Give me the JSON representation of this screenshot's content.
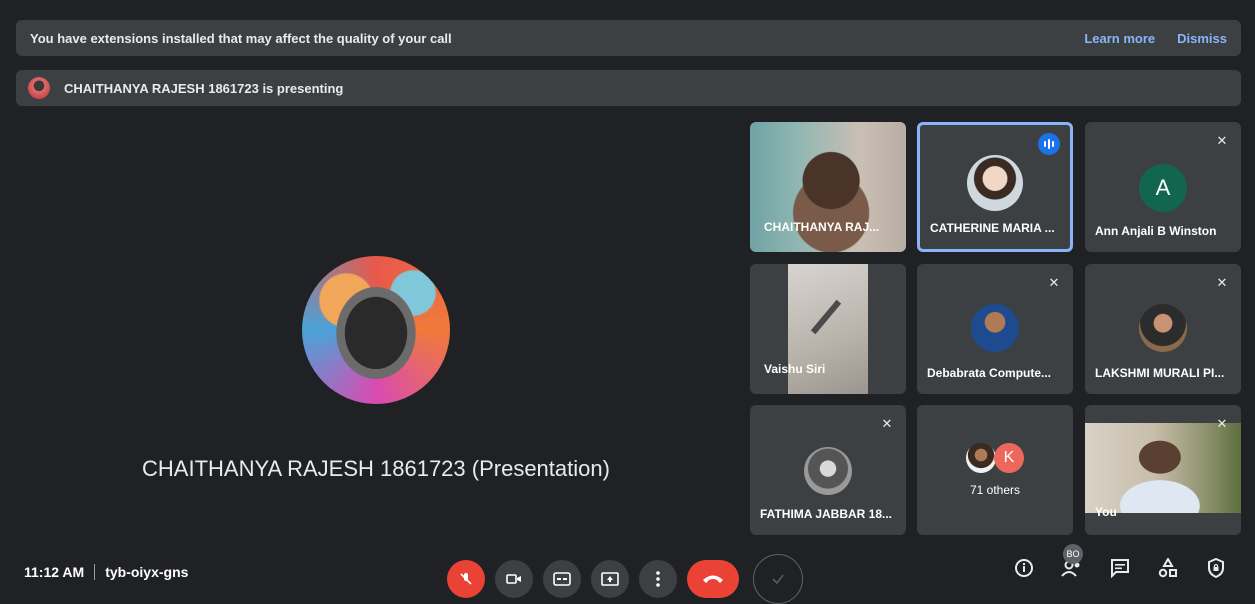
{
  "extension_banner": {
    "message": "You have extensions installed that may affect the quality of your call",
    "learn_more": "Learn more",
    "dismiss": "Dismiss"
  },
  "presenting_banner": {
    "text": "CHAITHANYA RAJESH 1861723 is presenting"
  },
  "main_tile": {
    "name": "CHAITHANYA RAJESH 1861723 (Presentation)"
  },
  "tiles": [
    {
      "label": "CHAITHANYA RAJ...",
      "muted": false,
      "kind": "video"
    },
    {
      "label": "CATHERINE MARIA ...",
      "muted": false,
      "speaking": true,
      "kind": "photo-avatar"
    },
    {
      "label": "Ann Anjali B Winston",
      "muted": true,
      "kind": "letter-avatar",
      "initial": "A"
    },
    {
      "label": "Vaishu Siri",
      "muted": false,
      "kind": "video"
    },
    {
      "label": "Debabrata Compute...",
      "muted": true,
      "kind": "photo-avatar"
    },
    {
      "label": "LAKSHMI MURALI PI...",
      "muted": true,
      "kind": "photo-avatar"
    },
    {
      "label": "FATHIMA JABBAR 18...",
      "muted": true,
      "kind": "photo-avatar"
    },
    {
      "label": "71 others",
      "initial": "K",
      "kind": "others"
    },
    {
      "label": "You",
      "muted": true,
      "kind": "video"
    }
  ],
  "bottom_bar": {
    "time": "11:12 AM",
    "meeting_code": "tyb-oiyx-gns",
    "people_badge": "BO"
  },
  "colors": {
    "background": "#202124",
    "surface": "#3c4043",
    "accent": "#8ab4f8",
    "danger": "#ea4335",
    "letter_avatar": "#12664f"
  }
}
